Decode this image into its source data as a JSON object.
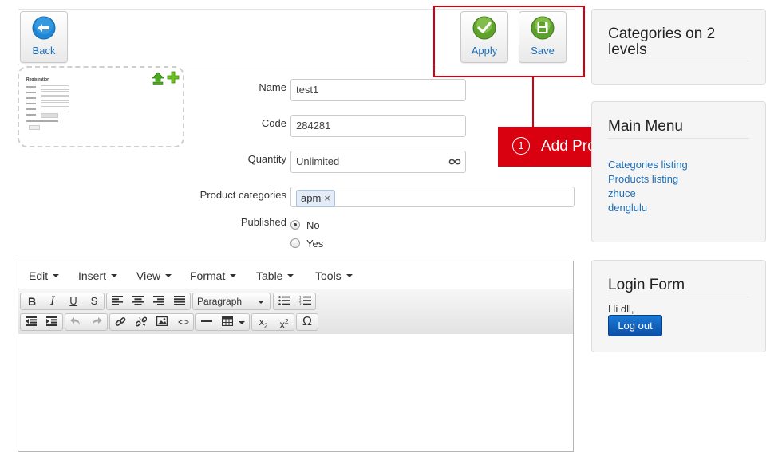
{
  "toolbar": {
    "back_label": "Back",
    "apply_label": "Apply",
    "save_label": "Save"
  },
  "annotation": {
    "number": "1",
    "text": "Add Product",
    "color": "#d9000f"
  },
  "image_preview": {
    "title": "Registration"
  },
  "form": {
    "name_label": "Name",
    "name_value": "test1",
    "code_label": "Code",
    "code_value": "284281",
    "quantity_label": "Quantity",
    "quantity_value": "Unlimited",
    "quantity_icon": "infinity-icon",
    "categories_label": "Product categories",
    "category_tag": "apm",
    "published_label": "Published",
    "published_options": [
      "No",
      "Yes"
    ],
    "published_selected": "No"
  },
  "editor": {
    "menus": [
      "Edit",
      "Insert",
      "View",
      "Format",
      "Table",
      "Tools"
    ],
    "block_format": "Paragraph"
  },
  "sidebar": {
    "categories_title": "Categories on 2 levels",
    "main_menu_title": "Main Menu",
    "main_menu_items": [
      "Categories listing",
      "Products listing",
      "zhuce",
      "denglulu"
    ],
    "login_title": "Login Form",
    "greeting": "Hi dll,",
    "logout_label": "Log out",
    "accent": "#1d6fb8"
  }
}
